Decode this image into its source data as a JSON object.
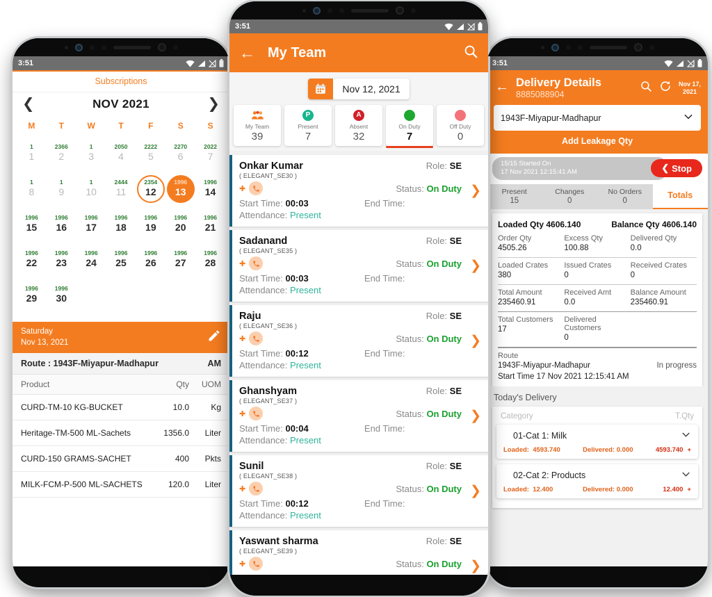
{
  "status_bar": {
    "time": "3:51"
  },
  "phone1": {
    "header_title": "Subscriptions",
    "calendar": {
      "month_label": "NOV 2021",
      "prev_icon": "chevron-left-icon",
      "next_icon": "chevron-right-icon",
      "dow": [
        "M",
        "T",
        "W",
        "T",
        "F",
        "S",
        "S"
      ],
      "days": [
        {
          "d": "1",
          "v": "1",
          "state": "dim"
        },
        {
          "d": "2",
          "v": "2366",
          "state": "dim"
        },
        {
          "d": "3",
          "v": "1",
          "state": "dim"
        },
        {
          "d": "4",
          "v": "2050",
          "state": "dim"
        },
        {
          "d": "5",
          "v": "2222",
          "state": "dim"
        },
        {
          "d": "6",
          "v": "2270",
          "state": "dim"
        },
        {
          "d": "7",
          "v": "2022",
          "state": "dim"
        },
        {
          "d": "8",
          "v": "1",
          "state": "dim"
        },
        {
          "d": "9",
          "v": "1",
          "state": "dim"
        },
        {
          "d": "10",
          "v": "1",
          "state": "dim"
        },
        {
          "d": "11",
          "v": "2444",
          "state": "dim"
        },
        {
          "d": "12",
          "v": "2354",
          "state": "ring"
        },
        {
          "d": "13",
          "v": "1996",
          "state": "fill"
        },
        {
          "d": "14",
          "v": "1996",
          "state": "normal"
        },
        {
          "d": "15",
          "v": "1996",
          "state": "normal"
        },
        {
          "d": "16",
          "v": "1996",
          "state": "normal"
        },
        {
          "d": "17",
          "v": "1996",
          "state": "normal"
        },
        {
          "d": "18",
          "v": "1996",
          "state": "normal"
        },
        {
          "d": "19",
          "v": "1996",
          "state": "normal"
        },
        {
          "d": "20",
          "v": "1996",
          "state": "normal"
        },
        {
          "d": "21",
          "v": "1996",
          "state": "normal"
        },
        {
          "d": "22",
          "v": "1996",
          "state": "normal"
        },
        {
          "d": "23",
          "v": "1996",
          "state": "normal"
        },
        {
          "d": "24",
          "v": "1996",
          "state": "normal"
        },
        {
          "d": "25",
          "v": "1996",
          "state": "normal"
        },
        {
          "d": "26",
          "v": "1996",
          "state": "normal"
        },
        {
          "d": "27",
          "v": "1996",
          "state": "normal"
        },
        {
          "d": "28",
          "v": "1996",
          "state": "normal"
        },
        {
          "d": "29",
          "v": "1996",
          "state": "normal"
        },
        {
          "d": "30",
          "v": "1996",
          "state": "normal"
        }
      ]
    },
    "day_bar": {
      "weekday": "Saturday",
      "date": "Nov 13, 2021",
      "edit_icon": "pencil-icon"
    },
    "route_row": {
      "label": "Route : 1943F-Miyapur-Madhapur",
      "session": "AM"
    },
    "table": {
      "columns": [
        "Product",
        "Qty",
        "UOM"
      ],
      "rows": [
        {
          "product": "CURD-TM-10 KG-BUCKET",
          "qty": "10.0",
          "uom": "Kg"
        },
        {
          "product": "Heritage-TM-500 ML-Sachets",
          "qty": "1356.0",
          "uom": "Liter"
        },
        {
          "product": "CURD-150 GRAMS-SACHET",
          "qty": "400",
          "uom": "Pkts"
        },
        {
          "product": "MILK-FCM-P-500 ML-SACHETS",
          "qty": "120.0",
          "uom": "Liter"
        }
      ]
    }
  },
  "phone2": {
    "appbar": {
      "back_icon": "back-arrow-icon",
      "title": "My Team",
      "search_icon": "search-icon"
    },
    "date_picker": {
      "calendar_icon": "calendar-icon",
      "value": "Nov 12, 2021"
    },
    "stats": [
      {
        "label": "My Team",
        "value": "39",
        "icon": "people-icon",
        "color": "#f47c20",
        "active": false
      },
      {
        "label": "Present",
        "value": "7",
        "icon": "present-badge-icon",
        "color": "#18b58c",
        "active": false
      },
      {
        "label": "Absent",
        "value": "32",
        "icon": "absent-badge-icon",
        "color": "#d21f2a",
        "active": false
      },
      {
        "label": "On Duty",
        "value": "7",
        "icon": "on-duty-dot-icon",
        "color": "#1fa82f",
        "active": true
      },
      {
        "label": "Off Duty",
        "value": "0",
        "icon": "off-duty-dot-icon",
        "color": "#f4737a",
        "active": false
      }
    ],
    "labels": {
      "role": "Role:",
      "status": "Status:",
      "start_time": "Start Time:",
      "end_time": "End Time:",
      "attendance": "Attendance:",
      "phone_icon": "phone-icon",
      "chevron_icon": "chevron-right-icon"
    },
    "members": [
      {
        "name": "Onkar Kumar",
        "id": "( ELEGANT_SE30 )",
        "role": "SE",
        "status": "On Duty",
        "start": "00:03",
        "end": "",
        "attendance": "Present"
      },
      {
        "name": "Sadanand",
        "id": "( ELEGANT_SE35 )",
        "role": "SE",
        "status": "On Duty",
        "start": "00:03",
        "end": "",
        "attendance": "Present"
      },
      {
        "name": "Raju",
        "id": "( ELEGANT_SE36 )",
        "role": "SE",
        "status": "On Duty",
        "start": "00:12",
        "end": "",
        "attendance": "Present"
      },
      {
        "name": "Ghanshyam",
        "id": "( ELEGANT_SE37 )",
        "role": "SE",
        "status": "On Duty",
        "start": "00:04",
        "end": "",
        "attendance": "Present"
      },
      {
        "name": "Sunil",
        "id": "( ELEGANT_SE38 )",
        "role": "SE",
        "status": "On Duty",
        "start": "00:12",
        "end": "",
        "attendance": "Present"
      },
      {
        "name": "Yaswant sharma",
        "id": "( ELEGANT_SE39 )",
        "role": "SE",
        "status": "On Duty",
        "start": "",
        "end": "",
        "attendance": ""
      }
    ]
  },
  "phone3": {
    "appbar": {
      "back_icon": "back-arrow-icon",
      "title": "Delivery Details",
      "subtitle": "8885088904",
      "search_icon": "search-icon",
      "refresh_icon": "refresh-icon",
      "date_line1": "Nov 17,",
      "date_line2": "2021"
    },
    "route_select": {
      "value": "1943F-Miyapur-Madhapur",
      "chevron_icon": "chevron-down-icon"
    },
    "add_leakage_label": "Add Leakage Qty",
    "start_strip": {
      "line1": "15/15 Started On",
      "line2": "17 Nov 2021 12:15:41 AM",
      "stop_label": "Stop",
      "stop_icon": "chevron-left-icon"
    },
    "tabs": [
      {
        "label": "Present",
        "value": "15",
        "active": false
      },
      {
        "label": "Changes",
        "value": "0",
        "active": false
      },
      {
        "label": "No Orders",
        "value": "0",
        "active": false
      },
      {
        "label": "Totals",
        "value": "",
        "active": true
      }
    ],
    "totals": {
      "loaded_qty_label": "Loaded Qty 4606.140",
      "balance_qty_label": "Balance Qty 4606.140",
      "row1": [
        {
          "label": "Order Qty",
          "value": "4505.26"
        },
        {
          "label": "Excess Qty",
          "value": "100.88"
        },
        {
          "label": "Delivered Qty",
          "value": "0.0"
        }
      ],
      "row2": [
        {
          "label": "Loaded Crates",
          "value": "380"
        },
        {
          "label": "Issued Crates",
          "value": "0"
        },
        {
          "label": "Received Crates",
          "value": "0"
        }
      ],
      "row3": [
        {
          "label": "Total Amount",
          "value": "235460.91"
        },
        {
          "label": "Received Amt",
          "value": "0.0"
        },
        {
          "label": "Balance Amount",
          "value": "235460.91"
        }
      ],
      "row4": [
        {
          "label": "Total Customers",
          "value": "17"
        },
        {
          "label": "Delivered Customers",
          "value": "0"
        }
      ],
      "route_label": "Route",
      "route_value": "1943F-Miyapur-Madhapur",
      "route_status": "In progress",
      "start_time": "Start Time 17 Nov 2021 12:15:41 AM"
    },
    "todays_delivery": {
      "title": "Today's Delivery",
      "col_category": "Category",
      "col_tqty": "T.Qty",
      "categories": [
        {
          "name": "01-Cat 1: Milk",
          "loaded_label": "Loaded:",
          "loaded": "4593.740",
          "delivered_label": "Delivered: 0.000",
          "total": "4593.740",
          "chevron_icon": "chevron-down-icon",
          "plus": "+"
        },
        {
          "name": "02-Cat 2: Products",
          "loaded_label": "Loaded:",
          "loaded": "12.400",
          "delivered_label": "Delivered: 0.000",
          "total": "12.400",
          "chevron_icon": "chevron-down-icon",
          "plus": "+"
        }
      ]
    }
  }
}
